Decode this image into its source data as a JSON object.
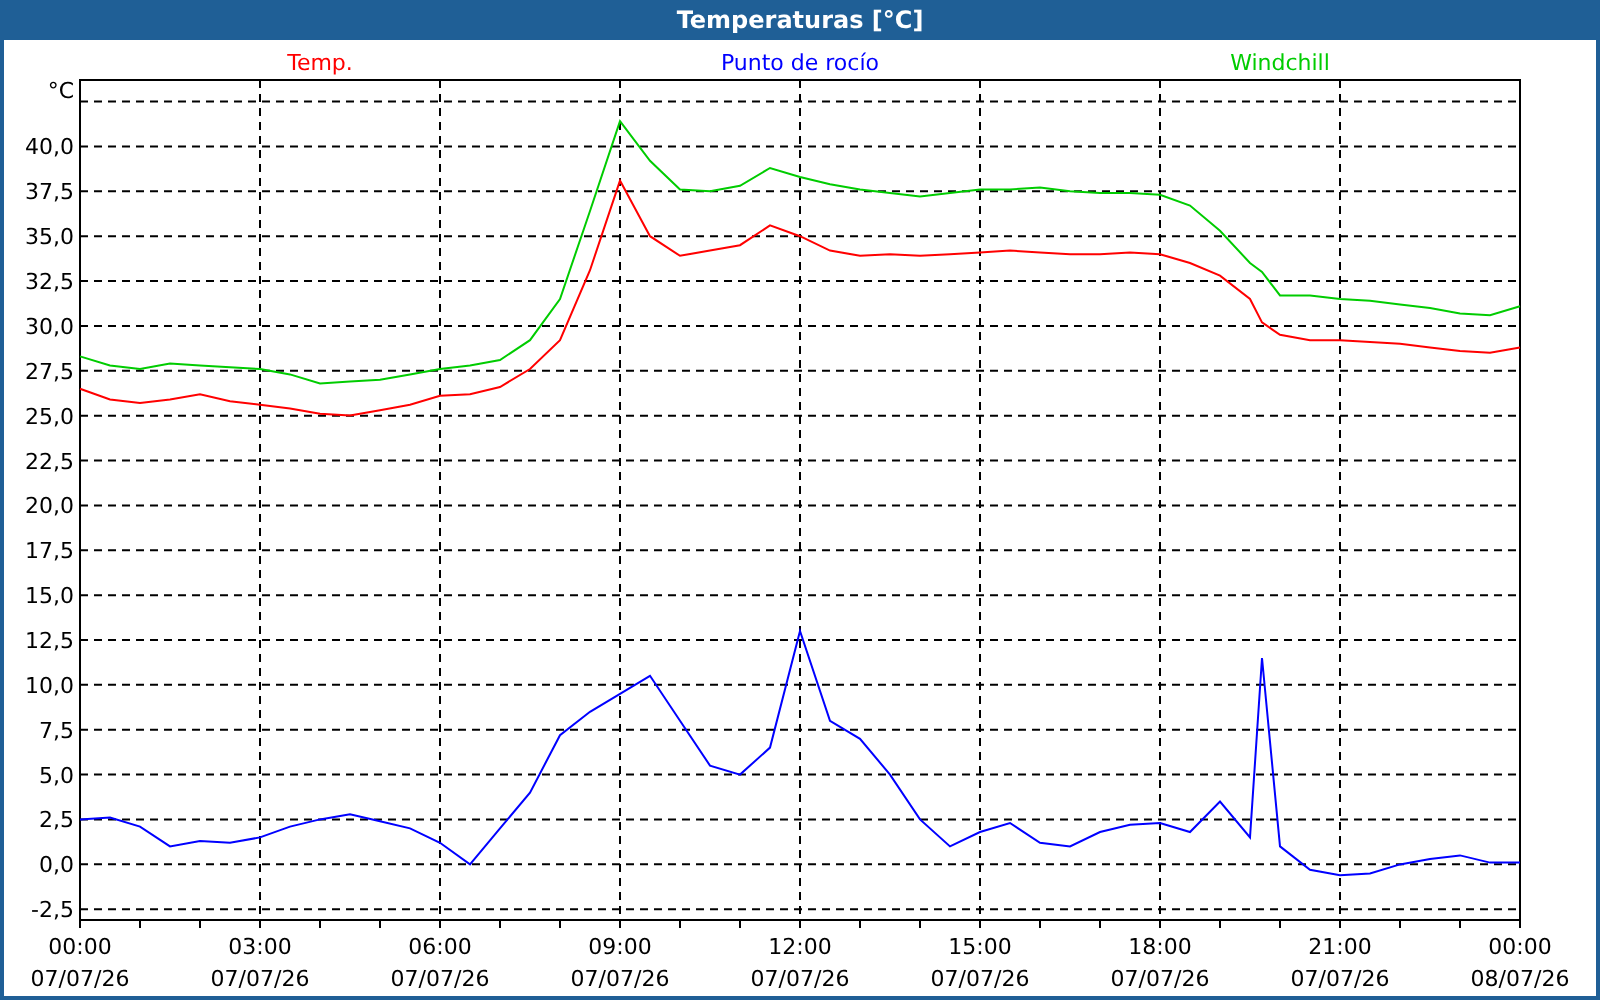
{
  "window": {
    "title": "Temperaturas [°C]"
  },
  "chart": {
    "chart_data": {
      "type": "line",
      "ylabel": "°C",
      "x": [
        0,
        0.5,
        1,
        1.5,
        2,
        2.5,
        3,
        3.5,
        4,
        4.5,
        5,
        5.5,
        6,
        6.5,
        7,
        7.5,
        8,
        8.5,
        9,
        9.5,
        10,
        10.5,
        11,
        11.5,
        12,
        12.5,
        13,
        13.5,
        14,
        14.5,
        15,
        15.5,
        16,
        16.5,
        17,
        17.5,
        18,
        18.5,
        19,
        19.5,
        19.7,
        20,
        20.5,
        21,
        21.5,
        22,
        22.5,
        23,
        23.5,
        24
      ],
      "series": [
        {
          "name": "Temp.",
          "color": "#ff0000",
          "values": [
            26.5,
            25.9,
            25.7,
            25.9,
            26.2,
            25.8,
            25.6,
            25.4,
            25.1,
            25.0,
            25.3,
            25.6,
            26.1,
            26.2,
            26.6,
            27.6,
            29.2,
            33.1,
            38.1,
            35.0,
            33.9,
            34.2,
            34.5,
            35.6,
            35.0,
            34.2,
            33.9,
            34.0,
            33.9,
            34.0,
            34.1,
            34.2,
            34.1,
            34.0,
            34.0,
            34.1,
            34.0,
            33.5,
            32.8,
            31.5,
            30.2,
            29.5,
            29.2,
            29.2,
            29.1,
            29.0,
            28.8,
            28.6,
            28.5,
            28.8
          ]
        },
        {
          "name": "Punto de rocío",
          "color": "#0000ff",
          "values": [
            2.5,
            2.6,
            2.1,
            1.0,
            1.3,
            1.2,
            1.5,
            2.1,
            2.5,
            2.8,
            2.4,
            2.0,
            1.2,
            0.0,
            2.0,
            4.0,
            7.2,
            8.5,
            9.5,
            10.5,
            8.0,
            5.5,
            5.0,
            6.5,
            13.0,
            8.0,
            7.0,
            5.0,
            2.5,
            1.0,
            1.8,
            2.3,
            1.2,
            1.0,
            1.8,
            2.2,
            2.3,
            1.8,
            3.5,
            1.5,
            11.5,
            1.0,
            -0.3,
            -0.6,
            -0.5,
            0.0,
            0.3,
            0.5,
            0.1,
            0.1
          ]
        },
        {
          "name": "Windchill",
          "color": "#00cc00",
          "values": [
            28.3,
            27.8,
            27.6,
            27.9,
            27.8,
            27.7,
            27.6,
            27.3,
            26.8,
            26.9,
            27.0,
            27.3,
            27.6,
            27.8,
            28.1,
            29.2,
            31.5,
            36.4,
            41.4,
            39.2,
            37.6,
            37.5,
            37.8,
            38.8,
            38.3,
            37.9,
            37.6,
            37.4,
            37.2,
            37.4,
            37.6,
            37.6,
            37.7,
            37.5,
            37.4,
            37.4,
            37.3,
            36.7,
            35.3,
            33.5,
            33.0,
            31.7,
            31.7,
            31.5,
            31.4,
            31.2,
            31.0,
            30.7,
            30.6,
            31.1
          ]
        }
      ],
      "grid": true,
      "xlim": [
        0,
        24
      ],
      "ylim": [
        -3.1,
        43.7
      ],
      "xticks": [
        {
          "value": 0,
          "label": "00:00"
        },
        {
          "value": 3,
          "label": "03:00"
        },
        {
          "value": 6,
          "label": "06:00"
        },
        {
          "value": 9,
          "label": "09:00"
        },
        {
          "value": 12,
          "label": "12:00"
        },
        {
          "value": 15,
          "label": "15:00"
        },
        {
          "value": 18,
          "label": "18:00"
        },
        {
          "value": 21,
          "label": "21:00"
        },
        {
          "value": 24,
          "label": "00:00"
        }
      ],
      "yticks": [
        {
          "value": -2.5,
          "label": "-2,5"
        },
        {
          "value": 0,
          "label": "0,0"
        },
        {
          "value": 2.5,
          "label": "2,5"
        },
        {
          "value": 5,
          "label": "5,0"
        },
        {
          "value": 7.5,
          "label": "7,5"
        },
        {
          "value": 10,
          "label": "10,0"
        },
        {
          "value": 12.5,
          "label": "12,5"
        },
        {
          "value": 15,
          "label": "15,0"
        },
        {
          "value": 17.5,
          "label": "17,5"
        },
        {
          "value": 20,
          "label": "20,0"
        },
        {
          "value": 22.5,
          "label": "22,5"
        },
        {
          "value": 25,
          "label": "25,0"
        },
        {
          "value": 27.5,
          "label": "27,5"
        },
        {
          "value": 30,
          "label": "30,0"
        },
        {
          "value": 32.5,
          "label": "32,5"
        },
        {
          "value": 35,
          "label": "35,0"
        },
        {
          "value": 37.5,
          "label": "37,5"
        },
        {
          "value": 40,
          "label": "40,0"
        }
      ]
    },
    "x_axis_dates": [
      "07/07/26",
      "07/07/26",
      "07/07/26",
      "07/07/26",
      "07/07/26",
      "07/07/26",
      "07/07/26",
      "07/07/26",
      "08/07/26"
    ]
  }
}
